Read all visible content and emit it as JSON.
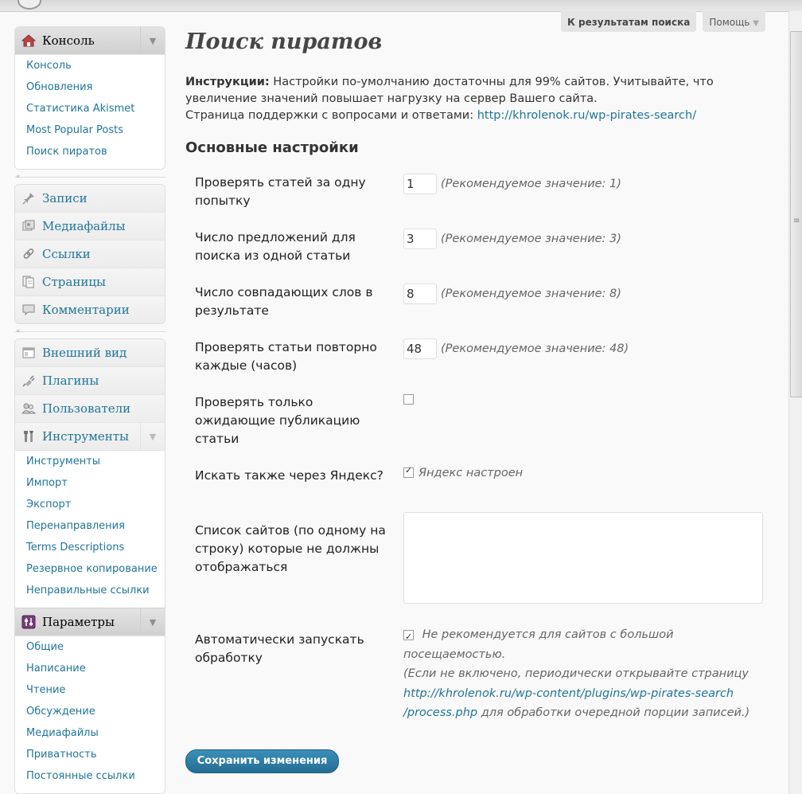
{
  "screen_meta": {
    "back_to_search": "К результатам поиска",
    "help": "Помощь",
    "help_arrow": "▼"
  },
  "sidebar": {
    "dashboard": {
      "label": "Консоль",
      "items": [
        "Консоль",
        "Обновления",
        "Статистика Akismet",
        "Most Popular Posts",
        "Поиск пиратов"
      ]
    },
    "content_menu": [
      {
        "label": "Записи",
        "icon": "pin-icon"
      },
      {
        "label": "Медиафайлы",
        "icon": "media-icon"
      },
      {
        "label": "Ссылки",
        "icon": "links-icon"
      },
      {
        "label": "Страницы",
        "icon": "pages-icon"
      },
      {
        "label": "Комментарии",
        "icon": "comments-icon"
      }
    ],
    "appearance": {
      "label": "Внешний вид"
    },
    "plugins": {
      "label": "Плагины"
    },
    "users": {
      "label": "Пользователи"
    },
    "tools": {
      "label": "Инструменты",
      "items": [
        "Инструменты",
        "Импорт",
        "Экспорт",
        "Перенаправления",
        "Terms Descriptions",
        "Резервное копирование",
        "Неправильные ссылки"
      ]
    },
    "settings": {
      "label": "Параметры",
      "items": [
        "Общие",
        "Написание",
        "Чтение",
        "Обсуждение",
        "Медиафайлы",
        "Приватность",
        "Постоянные ссылки"
      ]
    }
  },
  "main": {
    "title": "Поиск пиратов",
    "instructions_label": "Инструкции:",
    "instructions_text": " Настройки по-умолчанию достаточны для 99% сайтов. Учитывайте, что увеличение значений повышает нагрузку на сервер Вашего сайта.",
    "support_label": "Страница поддержки с вопросами и ответами: ",
    "support_link": "http://khrolenok.ru/wp-pirates-search/",
    "section_title": "Основные настройки",
    "rows": [
      {
        "label": "Проверять статей за одну попытку",
        "value": "1",
        "hint": "(Рекомендуемое значение: 1)"
      },
      {
        "label": "Число предложений для поиска из одной статьи",
        "value": "3",
        "hint": "(Рекомендуемое значение: 3)"
      },
      {
        "label": "Число совпадающих слов в результате",
        "value": "8",
        "hint": "(Рекомендуемое значение: 8)"
      },
      {
        "label": "Проверять статьи повторно каждые (часов)",
        "value": "48",
        "hint": "(Рекомендуемое значение: 48)"
      }
    ],
    "pending_only": {
      "label": "Проверять только ожидающие публикацию статьи",
      "checked": false
    },
    "yandex": {
      "label": "Искать также через Яндекс?",
      "checked": true,
      "hint": "Яндекс настроен"
    },
    "exclude_sites": {
      "label": "Список сайтов (по одному на строку) которые не должны отображаться",
      "value": ""
    },
    "auto": {
      "label": "Автоматически запускать обработку",
      "checked": true,
      "hint": "Не рекомендуется для сайтов с большой посещаемостью.",
      "note_start": "(Если не включено, периодически открывайте страницу",
      "note_link_1": "http://khrolenok.ru/wp-content/plugins/wp-pirates-search",
      "note_link_2": "/process.php",
      "note_end": " для обработки очередной порции записей.)"
    },
    "save_label": "Сохранить изменения"
  }
}
